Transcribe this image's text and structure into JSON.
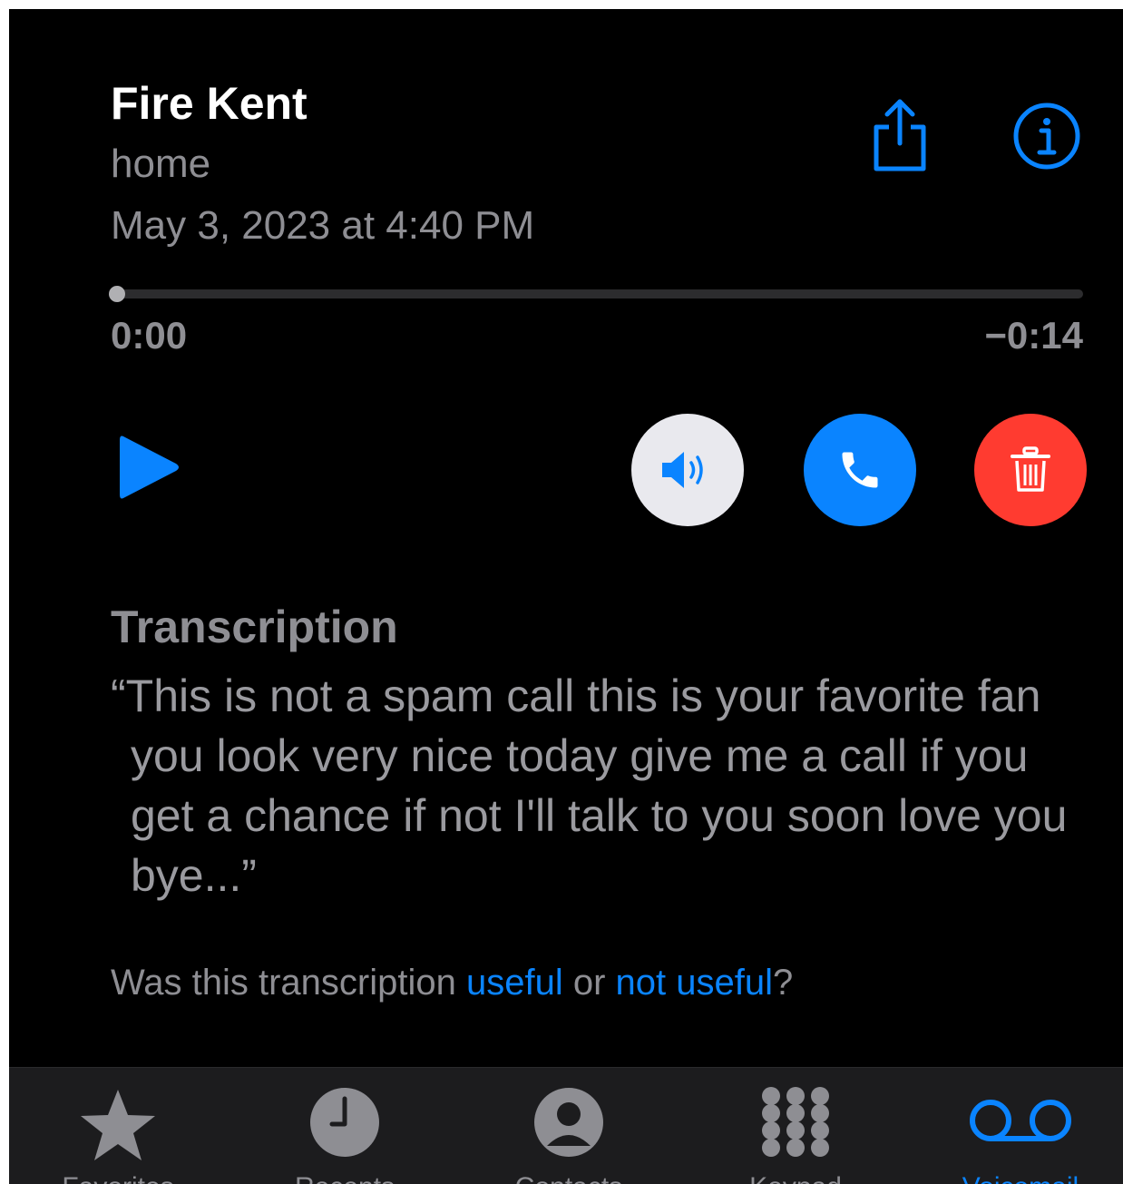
{
  "voicemail": {
    "contact_name": "Fire Kent",
    "contact_label": "home",
    "timestamp": "May 3, 2023 at 4:40 PM",
    "playback": {
      "elapsed": "0:00",
      "remaining": "−0:14",
      "progress": 0.0
    }
  },
  "actions": {
    "share_icon": "share-icon",
    "info_icon": "info-icon",
    "play_icon": "play-icon",
    "speaker_icon": "speaker-icon",
    "call_icon": "phone-icon",
    "delete_icon": "trash-icon"
  },
  "transcription": {
    "heading": "Transcription",
    "text": "“This is not a spam call this is your favorite fan you look very nice today give me a call if you get a chance if not I'll talk to you soon love you bye...”",
    "feedback_prefix": "Was this transcription ",
    "feedback_useful": "useful",
    "feedback_or": " or ",
    "feedback_not_useful": "not useful",
    "feedback_suffix": "?"
  },
  "tabbar": {
    "tabs": [
      {
        "label": "Favorites",
        "icon": "star-icon",
        "active": false
      },
      {
        "label": "Recents",
        "icon": "clock-icon",
        "active": false
      },
      {
        "label": "Contacts",
        "icon": "person-icon",
        "active": false
      },
      {
        "label": "Keypad",
        "icon": "keypad-icon",
        "active": false
      },
      {
        "label": "Voicemail",
        "icon": "voicemail-icon",
        "active": true
      }
    ]
  },
  "colors": {
    "accent": "#0a84ff",
    "delete": "#ff3b30",
    "background": "#000000",
    "secondary_text": "#8e8e93"
  }
}
